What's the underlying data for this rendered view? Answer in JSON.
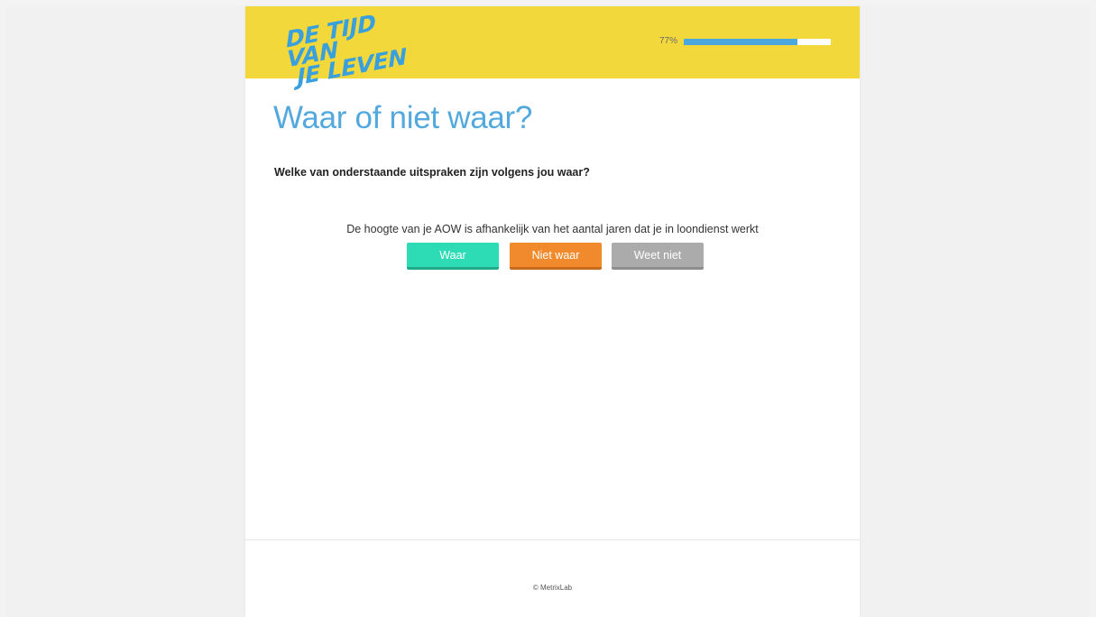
{
  "header": {
    "logo_line1": "DE TIJD VAN",
    "logo_line2": "JE LEVEN",
    "progress_label": "77%",
    "progress_value": 0.77
  },
  "main": {
    "title": "Waar of niet waar?",
    "question": "Welke van onderstaande uitspraken zijn volgens jou waar?",
    "statement": "De hoogte van je AOW is afhankelijk van het aantal jaren dat je in loondienst werkt",
    "buttons": {
      "true_label": "Waar",
      "false_label": "Niet waar",
      "unknown_label": "Weet niet"
    }
  },
  "footer": {
    "copyright": "© MetrixLab"
  },
  "colors": {
    "header_bg": "#f2d83a",
    "accent_blue": "#4aa8de",
    "button_true": "#2ddcb5",
    "button_false": "#f08a2c",
    "button_unknown": "#ababab"
  }
}
